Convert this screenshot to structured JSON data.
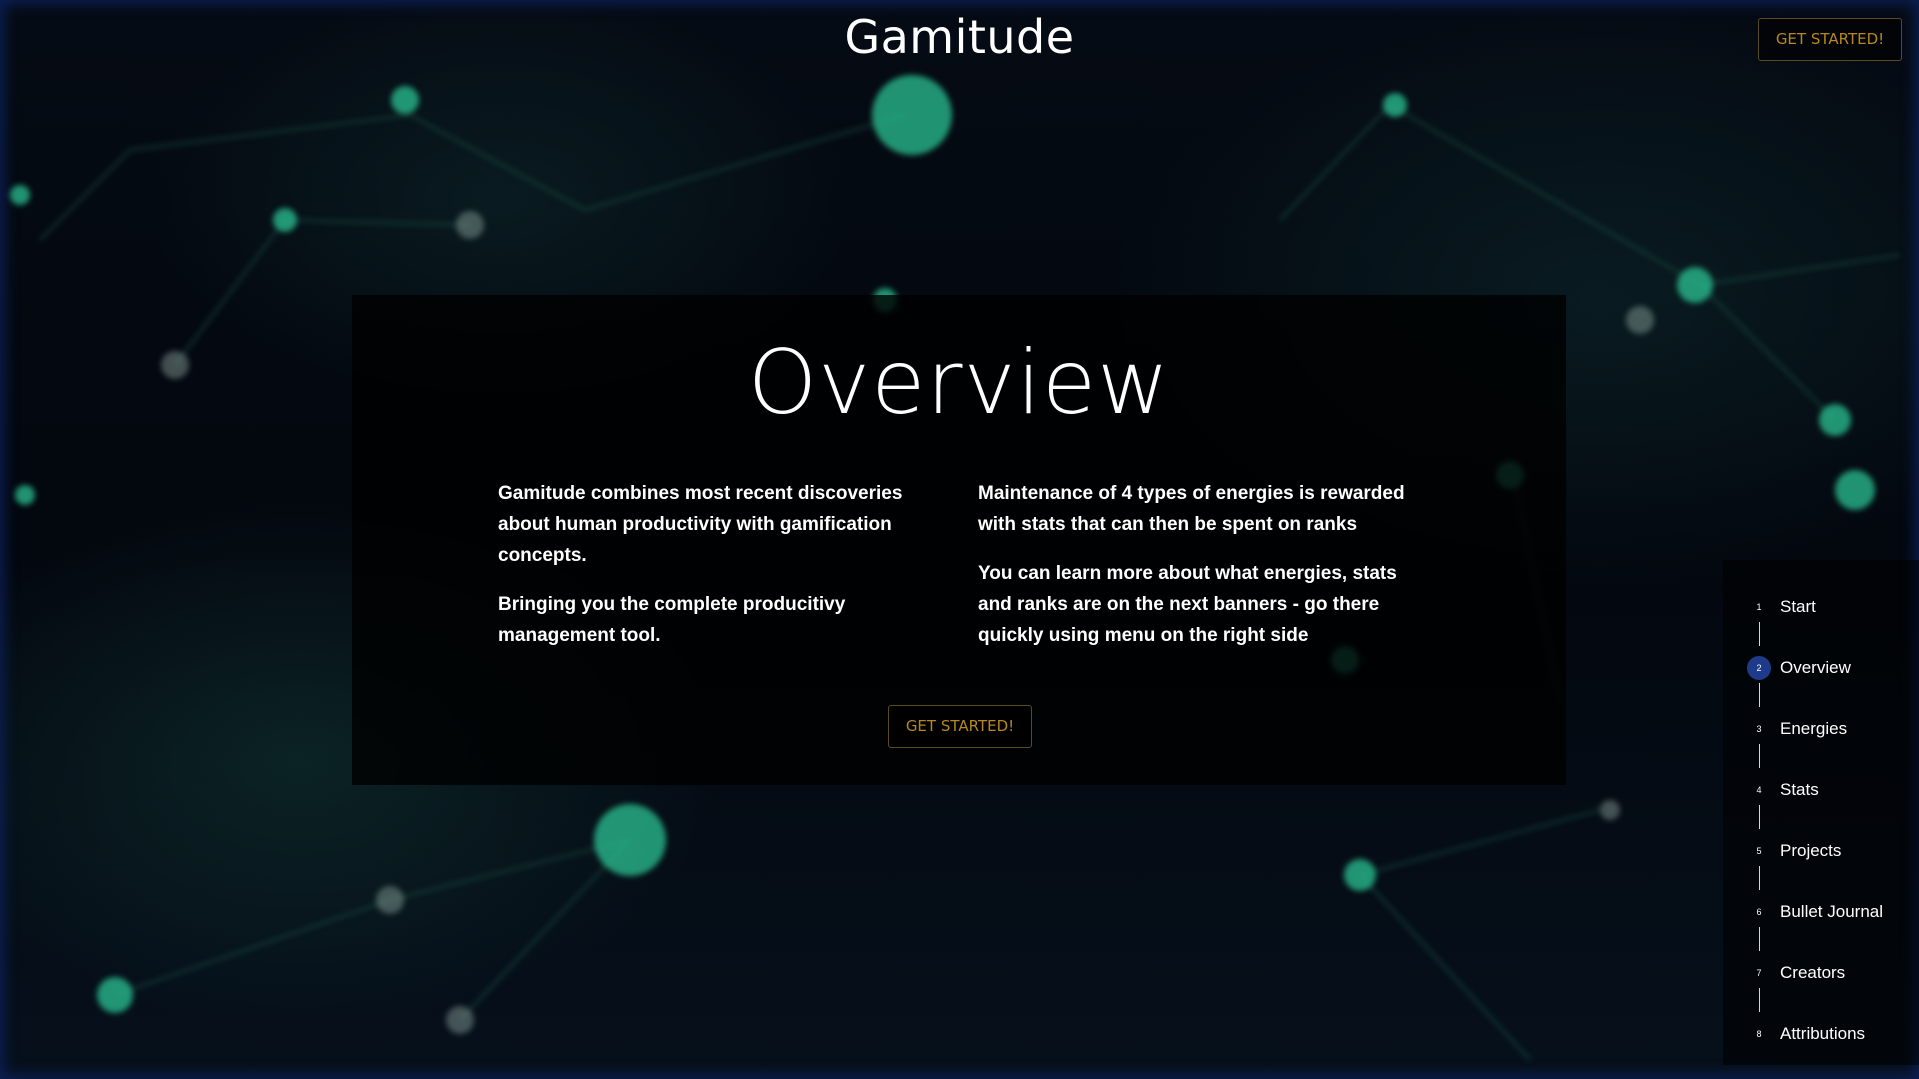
{
  "header": {
    "app_title": "Gamitude",
    "cta_label": "GET STARTED!"
  },
  "panel": {
    "title": "Overview",
    "left_paragraphs": [
      "Gamitude combines most recent discoveries about human productivity with gamification concepts.",
      "Bringing you the complete producitivy management tool."
    ],
    "right_paragraphs": [
      "Maintenance of 4 types of energies is rewarded with stats that can then be spent on ranks",
      "You can learn more about what energies, stats and ranks are on the next banners - go there quickly using menu on the right side"
    ],
    "cta_label": "GET STARTED!"
  },
  "sidenav": {
    "active_index": 2,
    "items": [
      {
        "num": "1",
        "label": "Start"
      },
      {
        "num": "2",
        "label": "Overview"
      },
      {
        "num": "3",
        "label": "Energies"
      },
      {
        "num": "4",
        "label": "Stats"
      },
      {
        "num": "5",
        "label": "Projects"
      },
      {
        "num": "6",
        "label": "Bullet Journal"
      },
      {
        "num": "7",
        "label": "Creators"
      },
      {
        "num": "8",
        "label": "Attributions"
      }
    ]
  },
  "colors": {
    "accent_gold": "#b5891f",
    "active_dot": "#1d3b8a",
    "glow_green": "#2fd6a0"
  }
}
